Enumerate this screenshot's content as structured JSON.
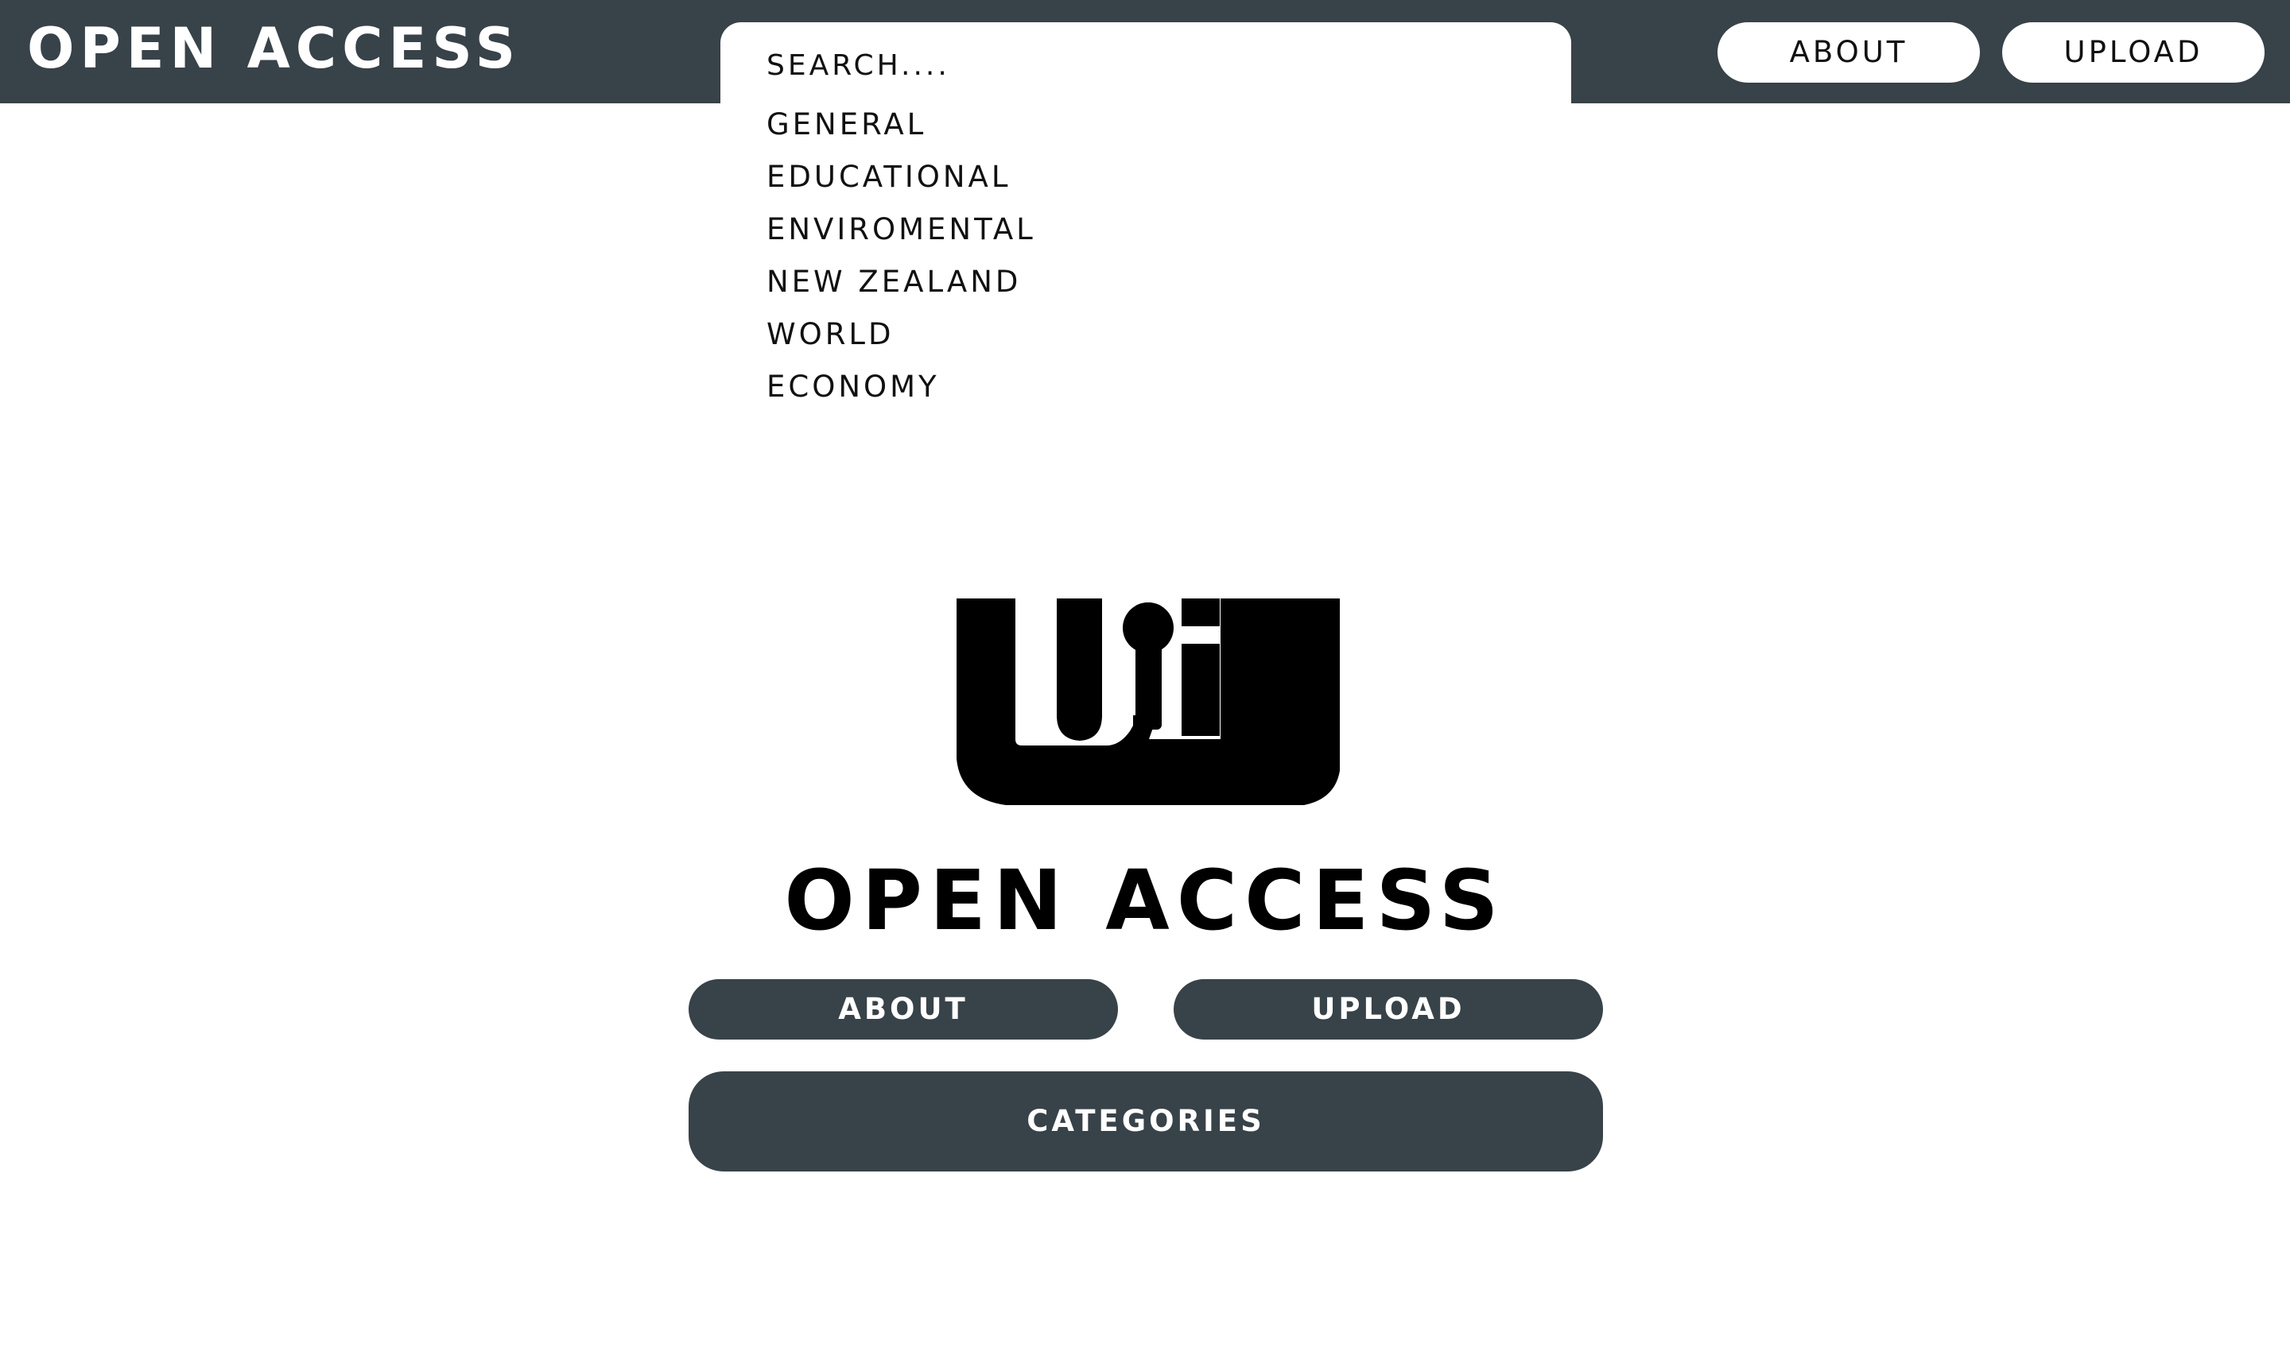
{
  "header": {
    "brand": "OPEN ACCESS",
    "search_placeholder": "SEARCH....",
    "about_label": "ABOUT",
    "upload_label": "UPLOAD"
  },
  "search_dropdown": {
    "categories": [
      "GENERAL",
      "EDUCATIONAL",
      "ENVIROMENTAL",
      "NEW ZEALAND",
      "WORLD",
      "ECONOMY"
    ]
  },
  "hero": {
    "title": "OPEN ACCESS",
    "about_label": "ABOUT",
    "upload_label": "UPLOAD",
    "categories_label": "CATEGORIES"
  },
  "colors": {
    "header_bg": "#384249",
    "button_dark": "#384249",
    "button_light": "#ffffff",
    "page_bg": "#ffffff",
    "logo": "#000000"
  },
  "icons": {
    "logo": "uoa-keyhole-logo-icon"
  }
}
